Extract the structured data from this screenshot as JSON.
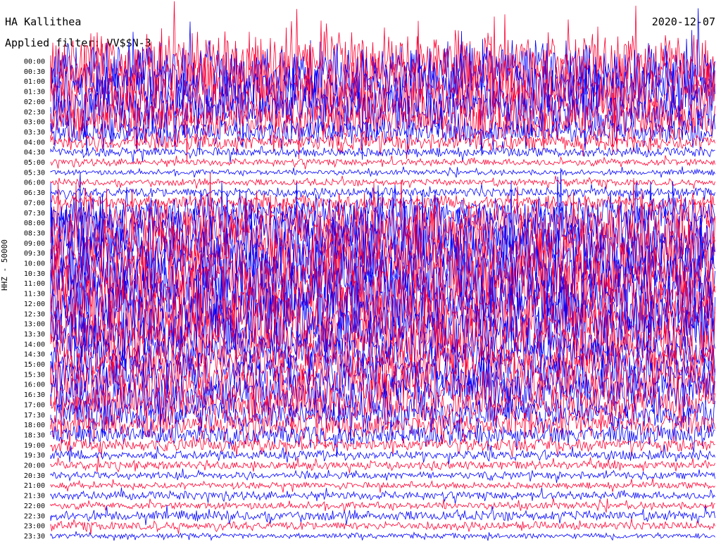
{
  "header": {
    "station": "HA Kallithea",
    "filter": "Applied filter: VV$$N-3",
    "date": "2020-12-07"
  },
  "chart_data": {
    "type": "line",
    "title": "HA Kallithea",
    "ylabel": "HHZ - 50000",
    "rows": [
      {
        "label": "00:00",
        "color": "#ff0033",
        "activity": 0.95
      },
      {
        "label": "00:30",
        "color": "#0000ff",
        "activity": 0.97
      },
      {
        "label": "01:00",
        "color": "#ff0033",
        "activity": 0.95
      },
      {
        "label": "01:30",
        "color": "#0000ff",
        "activity": 0.9
      },
      {
        "label": "02:00",
        "color": "#ff0033",
        "activity": 0.85
      },
      {
        "label": "02:30",
        "color": "#0000ff",
        "activity": 0.8
      },
      {
        "label": "03:00",
        "color": "#ff0033",
        "activity": 0.6
      },
      {
        "label": "03:30",
        "color": "#0000ff",
        "activity": 0.35
      },
      {
        "label": "04:00",
        "color": "#ff0033",
        "activity": 0.22
      },
      {
        "label": "04:30",
        "color": "#0000ff",
        "activity": 0.12
      },
      {
        "label": "05:00",
        "color": "#ff0033",
        "activity": 0.08
      },
      {
        "label": "05:30",
        "color": "#0000ff",
        "activity": 0.05
      },
      {
        "label": "06:00",
        "color": "#ff0033",
        "activity": 0.07
      },
      {
        "label": "06:30",
        "color": "#0000ff",
        "activity": 0.12
      },
      {
        "label": "07:00",
        "color": "#ff0033",
        "activity": 0.2
      },
      {
        "label": "07:30",
        "color": "#0000ff",
        "activity": 0.45
      },
      {
        "label": "08:00",
        "color": "#ff0033",
        "activity": 0.75
      },
      {
        "label": "08:30",
        "color": "#0000ff",
        "activity": 0.92
      },
      {
        "label": "09:00",
        "color": "#ff0033",
        "activity": 0.97
      },
      {
        "label": "09:30",
        "color": "#0000ff",
        "activity": 1.0
      },
      {
        "label": "10:00",
        "color": "#ff0033",
        "activity": 1.0
      },
      {
        "label": "10:30",
        "color": "#0000ff",
        "activity": 1.0
      },
      {
        "label": "11:00",
        "color": "#ff0033",
        "activity": 1.0
      },
      {
        "label": "11:30",
        "color": "#0000ff",
        "activity": 1.0
      },
      {
        "label": "12:00",
        "color": "#ff0033",
        "activity": 1.0
      },
      {
        "label": "12:30",
        "color": "#0000ff",
        "activity": 0.98
      },
      {
        "label": "13:00",
        "color": "#ff0033",
        "activity": 0.95
      },
      {
        "label": "13:30",
        "color": "#0000ff",
        "activity": 0.9
      },
      {
        "label": "14:00",
        "color": "#ff0033",
        "activity": 0.8
      },
      {
        "label": "14:30",
        "color": "#0000ff",
        "activity": 0.55
      },
      {
        "label": "15:00",
        "color": "#ff0033",
        "activity": 0.55
      },
      {
        "label": "15:30",
        "color": "#0000ff",
        "activity": 0.65
      },
      {
        "label": "16:00",
        "color": "#ff0033",
        "activity": 0.7
      },
      {
        "label": "16:30",
        "color": "#0000ff",
        "activity": 0.65
      },
      {
        "label": "17:00",
        "color": "#ff0033",
        "activity": 0.55
      },
      {
        "label": "17:30",
        "color": "#0000ff",
        "activity": 0.45
      },
      {
        "label": "18:00",
        "color": "#ff0033",
        "activity": 0.35
      },
      {
        "label": "18:30",
        "color": "#0000ff",
        "activity": 0.28
      },
      {
        "label": "19:00",
        "color": "#ff0033",
        "activity": 0.18
      },
      {
        "label": "19:30",
        "color": "#0000ff",
        "activity": 0.12
      },
      {
        "label": "20:00",
        "color": "#ff0033",
        "activity": 0.1
      },
      {
        "label": "20:30",
        "color": "#0000ff",
        "activity": 0.08
      },
      {
        "label": "21:00",
        "color": "#ff0033",
        "activity": 0.07
      },
      {
        "label": "21:30",
        "color": "#0000ff",
        "activity": 0.1
      },
      {
        "label": "22:00",
        "color": "#ff0033",
        "activity": 0.08
      },
      {
        "label": "22:30",
        "color": "#0000ff",
        "activity": 0.12
      },
      {
        "label": "23:00",
        "color": "#ff0033",
        "activity": 0.1
      },
      {
        "label": "23:30",
        "color": "#0000ff",
        "activity": 0.05
      }
    ]
  }
}
